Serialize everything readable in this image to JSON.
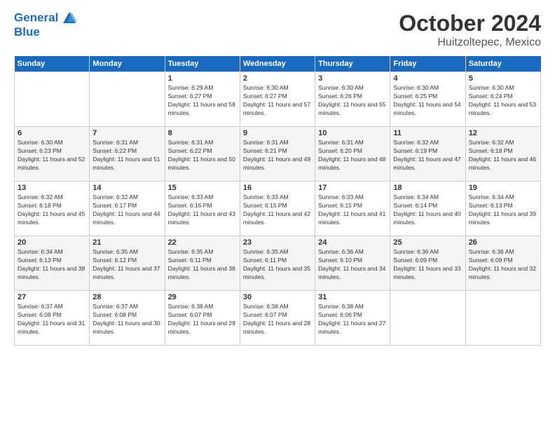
{
  "header": {
    "logo_line1": "General",
    "logo_line2": "Blue",
    "month": "October 2024",
    "location": "Huitzoltepec, Mexico"
  },
  "weekdays": [
    "Sunday",
    "Monday",
    "Tuesday",
    "Wednesday",
    "Thursday",
    "Friday",
    "Saturday"
  ],
  "weeks": [
    [
      {
        "day": "",
        "info": ""
      },
      {
        "day": "",
        "info": ""
      },
      {
        "day": "1",
        "info": "Sunrise: 6:29 AM\nSunset: 6:27 PM\nDaylight: 11 hours and 58 minutes."
      },
      {
        "day": "2",
        "info": "Sunrise: 6:30 AM\nSunset: 6:27 PM\nDaylight: 11 hours and 57 minutes."
      },
      {
        "day": "3",
        "info": "Sunrise: 6:30 AM\nSunset: 6:26 PM\nDaylight: 11 hours and 55 minutes."
      },
      {
        "day": "4",
        "info": "Sunrise: 6:30 AM\nSunset: 6:25 PM\nDaylight: 11 hours and 54 minutes."
      },
      {
        "day": "5",
        "info": "Sunrise: 6:30 AM\nSunset: 6:24 PM\nDaylight: 11 hours and 53 minutes."
      }
    ],
    [
      {
        "day": "6",
        "info": "Sunrise: 6:30 AM\nSunset: 6:23 PM\nDaylight: 11 hours and 52 minutes."
      },
      {
        "day": "7",
        "info": "Sunrise: 6:31 AM\nSunset: 6:22 PM\nDaylight: 11 hours and 51 minutes."
      },
      {
        "day": "8",
        "info": "Sunrise: 6:31 AM\nSunset: 6:22 PM\nDaylight: 11 hours and 50 minutes."
      },
      {
        "day": "9",
        "info": "Sunrise: 6:31 AM\nSunset: 6:21 PM\nDaylight: 11 hours and 49 minutes."
      },
      {
        "day": "10",
        "info": "Sunrise: 6:31 AM\nSunset: 6:20 PM\nDaylight: 11 hours and 48 minutes."
      },
      {
        "day": "11",
        "info": "Sunrise: 6:32 AM\nSunset: 6:19 PM\nDaylight: 11 hours and 47 minutes."
      },
      {
        "day": "12",
        "info": "Sunrise: 6:32 AM\nSunset: 6:18 PM\nDaylight: 11 hours and 46 minutes."
      }
    ],
    [
      {
        "day": "13",
        "info": "Sunrise: 6:32 AM\nSunset: 6:18 PM\nDaylight: 11 hours and 45 minutes."
      },
      {
        "day": "14",
        "info": "Sunrise: 6:32 AM\nSunset: 6:17 PM\nDaylight: 11 hours and 44 minutes."
      },
      {
        "day": "15",
        "info": "Sunrise: 6:33 AM\nSunset: 6:16 PM\nDaylight: 11 hours and 43 minutes."
      },
      {
        "day": "16",
        "info": "Sunrise: 6:33 AM\nSunset: 6:15 PM\nDaylight: 11 hours and 42 minutes."
      },
      {
        "day": "17",
        "info": "Sunrise: 6:33 AM\nSunset: 6:15 PM\nDaylight: 11 hours and 41 minutes."
      },
      {
        "day": "18",
        "info": "Sunrise: 6:34 AM\nSunset: 6:14 PM\nDaylight: 11 hours and 40 minutes."
      },
      {
        "day": "19",
        "info": "Sunrise: 6:34 AM\nSunset: 6:13 PM\nDaylight: 11 hours and 39 minutes."
      }
    ],
    [
      {
        "day": "20",
        "info": "Sunrise: 6:34 AM\nSunset: 6:13 PM\nDaylight: 11 hours and 38 minutes."
      },
      {
        "day": "21",
        "info": "Sunrise: 6:35 AM\nSunset: 6:12 PM\nDaylight: 11 hours and 37 minutes."
      },
      {
        "day": "22",
        "info": "Sunrise: 6:35 AM\nSunset: 6:11 PM\nDaylight: 11 hours and 36 minutes."
      },
      {
        "day": "23",
        "info": "Sunrise: 6:35 AM\nSunset: 6:11 PM\nDaylight: 11 hours and 35 minutes."
      },
      {
        "day": "24",
        "info": "Sunrise: 6:36 AM\nSunset: 6:10 PM\nDaylight: 11 hours and 34 minutes."
      },
      {
        "day": "25",
        "info": "Sunrise: 6:36 AM\nSunset: 6:09 PM\nDaylight: 11 hours and 33 minutes."
      },
      {
        "day": "26",
        "info": "Sunrise: 6:36 AM\nSunset: 6:09 PM\nDaylight: 11 hours and 32 minutes."
      }
    ],
    [
      {
        "day": "27",
        "info": "Sunrise: 6:37 AM\nSunset: 6:08 PM\nDaylight: 11 hours and 31 minutes."
      },
      {
        "day": "28",
        "info": "Sunrise: 6:37 AM\nSunset: 6:08 PM\nDaylight: 11 hours and 30 minutes."
      },
      {
        "day": "29",
        "info": "Sunrise: 6:38 AM\nSunset: 6:07 PM\nDaylight: 11 hours and 29 minutes."
      },
      {
        "day": "30",
        "info": "Sunrise: 6:38 AM\nSunset: 6:07 PM\nDaylight: 11 hours and 28 minutes."
      },
      {
        "day": "31",
        "info": "Sunrise: 6:38 AM\nSunset: 6:06 PM\nDaylight: 11 hours and 27 minutes."
      },
      {
        "day": "",
        "info": ""
      },
      {
        "day": "",
        "info": ""
      }
    ]
  ]
}
